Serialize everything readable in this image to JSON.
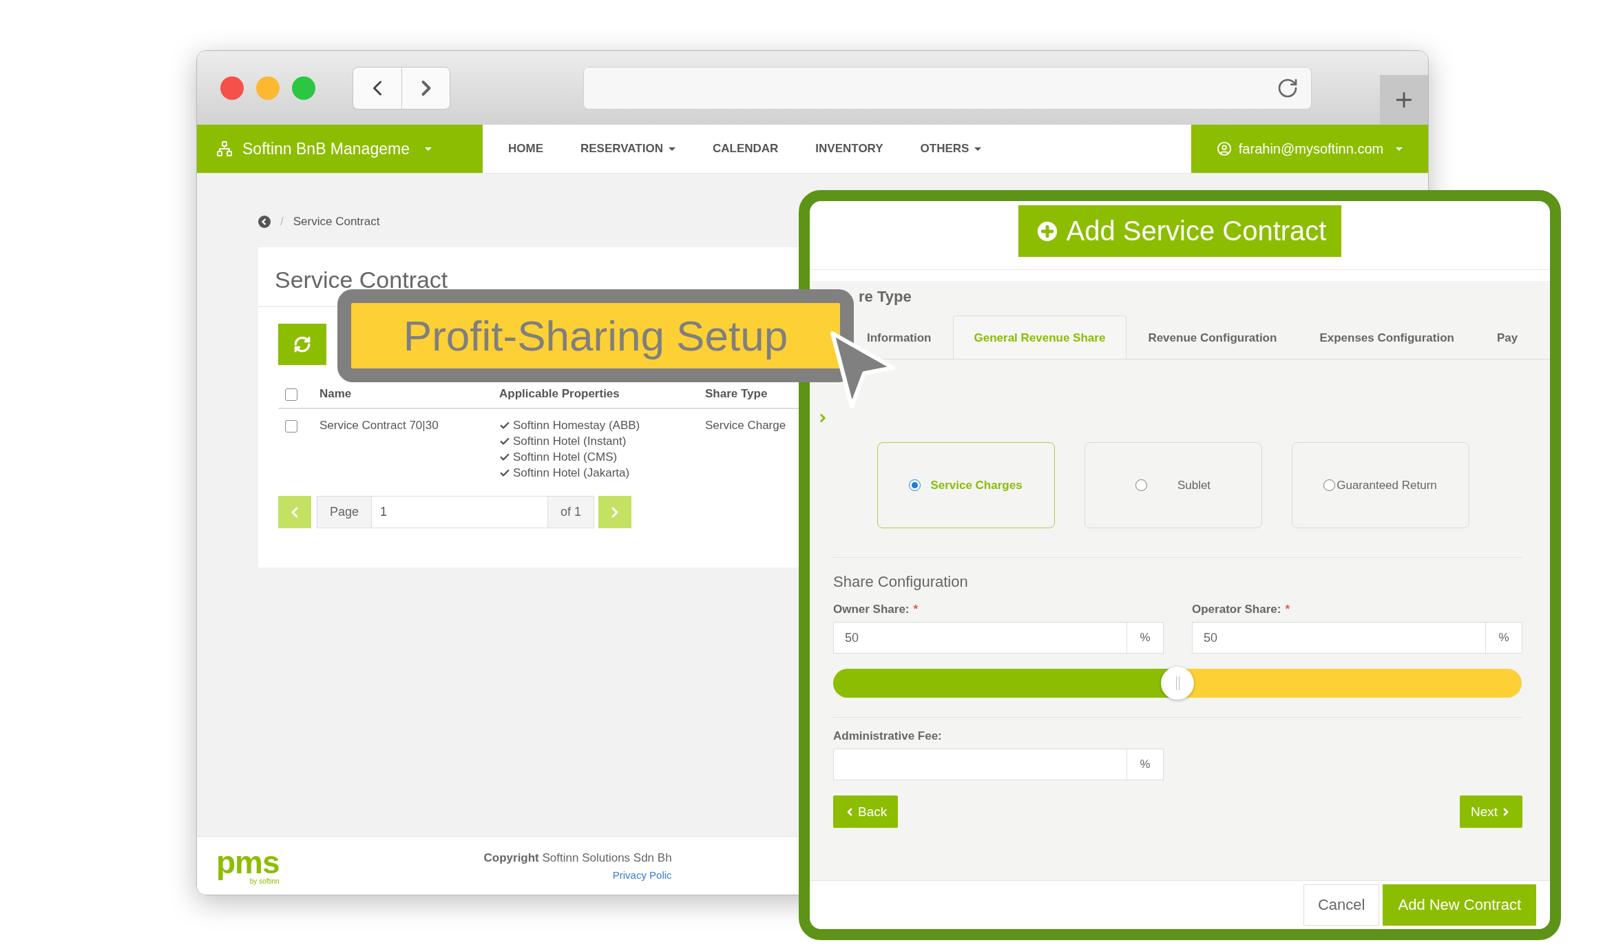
{
  "navbar": {
    "brand": "Softinn BnB Manageme",
    "brand_dropdown": true,
    "items": [
      {
        "label": "HOME",
        "dropdown": false
      },
      {
        "label": "RESERVATION",
        "dropdown": true
      },
      {
        "label": "CALENDAR",
        "dropdown": false
      },
      {
        "label": "INVENTORY",
        "dropdown": false
      },
      {
        "label": "OTHERS",
        "dropdown": true
      }
    ],
    "user": "farahin@mysoftinn.com",
    "user_dropdown": true
  },
  "breadcrumb": {
    "separator": "/",
    "current": "Service Contract"
  },
  "panel": {
    "title": "Service Contract",
    "header_checked": false,
    "columns": [
      "Name",
      "Applicable Properties",
      "Share Type"
    ],
    "rows": [
      {
        "checked": false,
        "name": "Service Contract 70|30",
        "properties": [
          "Softinn Homestay (ABB)",
          "Softinn Hotel (Instant)",
          "Softinn Hotel (CMS)",
          "Softinn Hotel (Jakarta)"
        ],
        "share_type": "Service Charge"
      }
    ],
    "pager": {
      "label": "Page",
      "value": "1",
      "total": "of 1"
    }
  },
  "footer": {
    "logo": "pms",
    "logo_sub": "by softinn",
    "copyright": "**Copyright** Softinn Solutions Sdn Bh",
    "privacy": "Privacy Polic"
  },
  "callout": {
    "text": "Profit-Sharing Setup"
  },
  "modal": {
    "title": "Add Service Contract",
    "section": "re Type",
    "tabs": [
      {
        "label": "Information",
        "selected": false
      },
      {
        "label": "General Revenue Share",
        "selected": true
      },
      {
        "label": "Revenue Configuration",
        "selected": false
      },
      {
        "label": "Expenses Configuration",
        "selected": false
      },
      {
        "label": "Pay",
        "selected": false
      }
    ],
    "share_types": [
      {
        "label": "Service Charges",
        "selected": true
      },
      {
        "label": "Sublet",
        "selected": false
      },
      {
        "label": "Guaranteed Return",
        "selected": false
      }
    ],
    "config_title": "Share Configuration",
    "owner": {
      "label": "Owner Share:",
      "required_mark": "*",
      "value": "50",
      "unit": "%"
    },
    "operator": {
      "label": "Operator Share:",
      "required_mark": "*",
      "value": "50",
      "unit": "%"
    },
    "slider": {
      "level": 0.5
    },
    "admin_fee": {
      "label": "Administrative Fee:",
      "unit": "%"
    },
    "back": "Back",
    "next": "Next",
    "footer_buttons": [
      {
        "label": "Cancel",
        "kind": "secondary"
      },
      {
        "label": "Add New Contract",
        "kind": "primary"
      }
    ]
  }
}
